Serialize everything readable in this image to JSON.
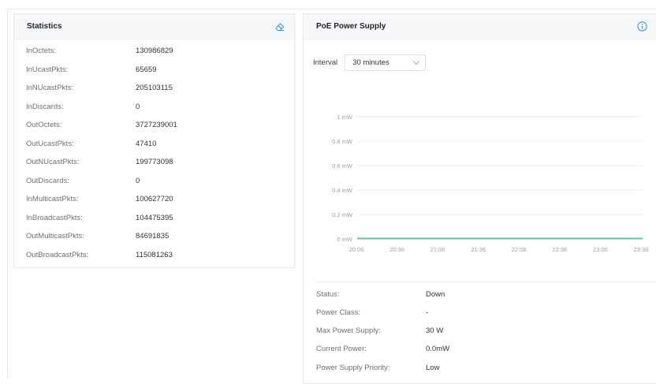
{
  "statistics": {
    "title": "Statistics",
    "clear_icon": "eraser-icon",
    "rows": [
      {
        "label": "InOctets:",
        "value": "130986829"
      },
      {
        "label": "InUcastPkts:",
        "value": "65659"
      },
      {
        "label": "InNUcastPkts:",
        "value": "205103115"
      },
      {
        "label": "InDiscards:",
        "value": "0"
      },
      {
        "label": "OutOctets:",
        "value": "3727239001"
      },
      {
        "label": "OutUcastPkts:",
        "value": "47410"
      },
      {
        "label": "OutNUcastPkts:",
        "value": "199773098"
      },
      {
        "label": "OutDiscards:",
        "value": "0"
      },
      {
        "label": "InMulticastPkts:",
        "value": "100627720"
      },
      {
        "label": "InBroadcastPkts:",
        "value": "104475395"
      },
      {
        "label": "OutMulticastPkts:",
        "value": "84691835"
      },
      {
        "label": "OutBroadcastPkts:",
        "value": "115081263"
      }
    ]
  },
  "poe": {
    "title": "PoE Power Supply",
    "info_icon": "info-icon",
    "interval_label": "Interval",
    "interval_value": "30 minutes",
    "details": [
      {
        "label": "Status:",
        "value": "Down"
      },
      {
        "label": "Power Class:",
        "value": "-"
      },
      {
        "label": "Max Power Supply:",
        "value": "30 W"
      },
      {
        "label": "Current Power:",
        "value": "0.0mW"
      },
      {
        "label": "Power Supply Priority:",
        "value": "Low"
      }
    ]
  },
  "chart_data": {
    "type": "line",
    "title": "",
    "xlabel": "",
    "ylabel": "",
    "x": [
      "20:06",
      "20:36",
      "21:06",
      "21:36",
      "22:06",
      "22:36",
      "23:06",
      "23:36"
    ],
    "yticks": [
      "0 mW",
      "0.2 mW",
      "0.4 mW",
      "0.6 mW",
      "0.8 mW",
      "1 mW"
    ],
    "ylim": [
      0,
      1
    ],
    "grid": true,
    "series": [
      {
        "values": [
          0,
          0,
          0,
          0,
          0,
          0,
          0,
          0
        ],
        "color": "#5cc9a7"
      }
    ],
    "grid_color": "#e9ebee",
    "axis_color": "#aeb3ba"
  }
}
